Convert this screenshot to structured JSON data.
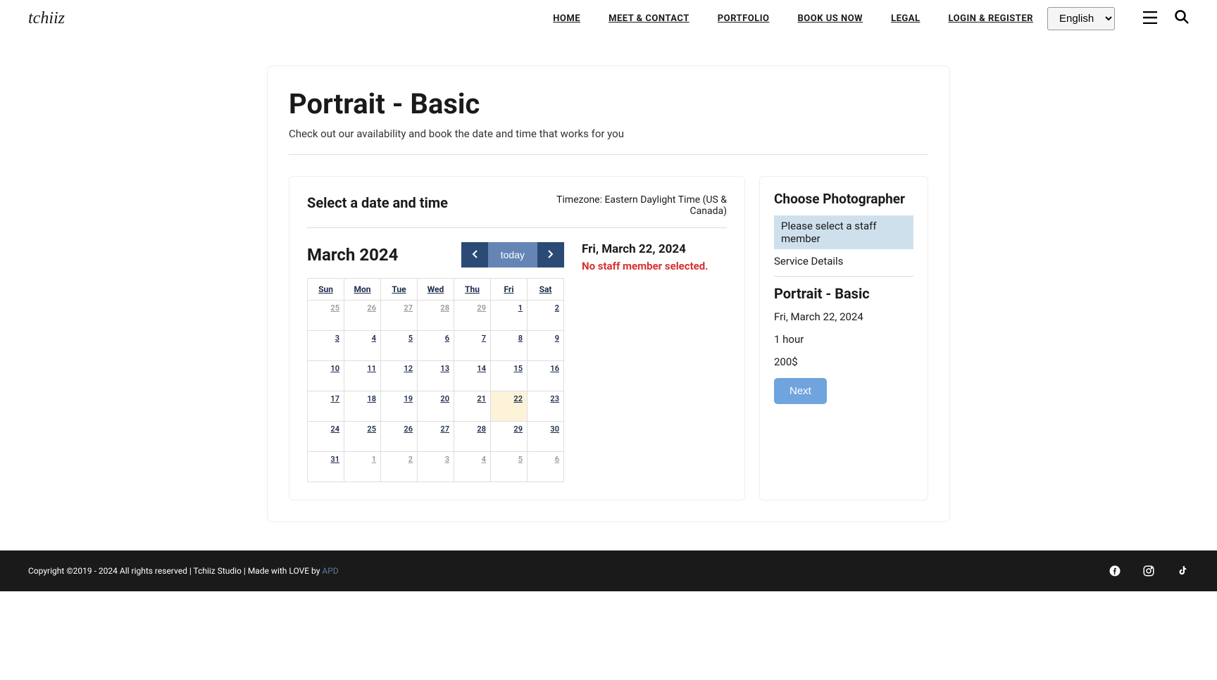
{
  "header": {
    "logo": "tchiiz",
    "nav": [
      "HOME",
      "MEET & CONTACT",
      "PORTFOLIO",
      "BOOK US NOW",
      "LEGAL",
      "LOGIN & REGISTER"
    ],
    "language": "English"
  },
  "page": {
    "title": "Portrait - Basic",
    "subtitle": "Check out our availability and book the date and time that works for you"
  },
  "booking": {
    "select_title": "Select a date and time",
    "timezone": "Timezone: Eastern Daylight Time (US & Canada)",
    "month_year": "March 2024",
    "today_label": "today",
    "days": [
      "Sun",
      "Mon",
      "Tue",
      "Wed",
      "Thu",
      "Fri",
      "Sat"
    ],
    "weeks": [
      [
        {
          "n": "25",
          "o": true
        },
        {
          "n": "26",
          "o": true
        },
        {
          "n": "27",
          "o": true
        },
        {
          "n": "28",
          "o": true
        },
        {
          "n": "29",
          "o": true
        },
        {
          "n": "1"
        },
        {
          "n": "2"
        }
      ],
      [
        {
          "n": "3"
        },
        {
          "n": "4"
        },
        {
          "n": "5"
        },
        {
          "n": "6"
        },
        {
          "n": "7"
        },
        {
          "n": "8"
        },
        {
          "n": "9"
        }
      ],
      [
        {
          "n": "10"
        },
        {
          "n": "11"
        },
        {
          "n": "12"
        },
        {
          "n": "13"
        },
        {
          "n": "14"
        },
        {
          "n": "15"
        },
        {
          "n": "16"
        }
      ],
      [
        {
          "n": "17"
        },
        {
          "n": "18"
        },
        {
          "n": "19"
        },
        {
          "n": "20"
        },
        {
          "n": "21"
        },
        {
          "n": "22",
          "sel": true
        },
        {
          "n": "23"
        }
      ],
      [
        {
          "n": "24"
        },
        {
          "n": "25"
        },
        {
          "n": "26"
        },
        {
          "n": "27"
        },
        {
          "n": "28"
        },
        {
          "n": "29"
        },
        {
          "n": "30"
        }
      ],
      [
        {
          "n": "31"
        },
        {
          "n": "1",
          "o": true
        },
        {
          "n": "2",
          "o": true
        },
        {
          "n": "3",
          "o": true
        },
        {
          "n": "4",
          "o": true
        },
        {
          "n": "5",
          "o": true
        },
        {
          "n": "6",
          "o": true
        }
      ]
    ],
    "selected_date": "Fri, March 22, 2024",
    "no_staff": "No staff member selected."
  },
  "sidebar": {
    "choose_title": "Choose Photographer",
    "staff_placeholder": "Please select a staff member",
    "service_details": "Service Details",
    "service_name": "Portrait - Basic",
    "service_date": "Fri, March 22, 2024",
    "duration": "1 hour",
    "price": "200$",
    "next": "Next"
  },
  "footer": {
    "copyright": "Copyright ©2019 - 2024 All rights reserved | Tchiiz Studio | Made with LOVE by ",
    "by": "APD"
  }
}
